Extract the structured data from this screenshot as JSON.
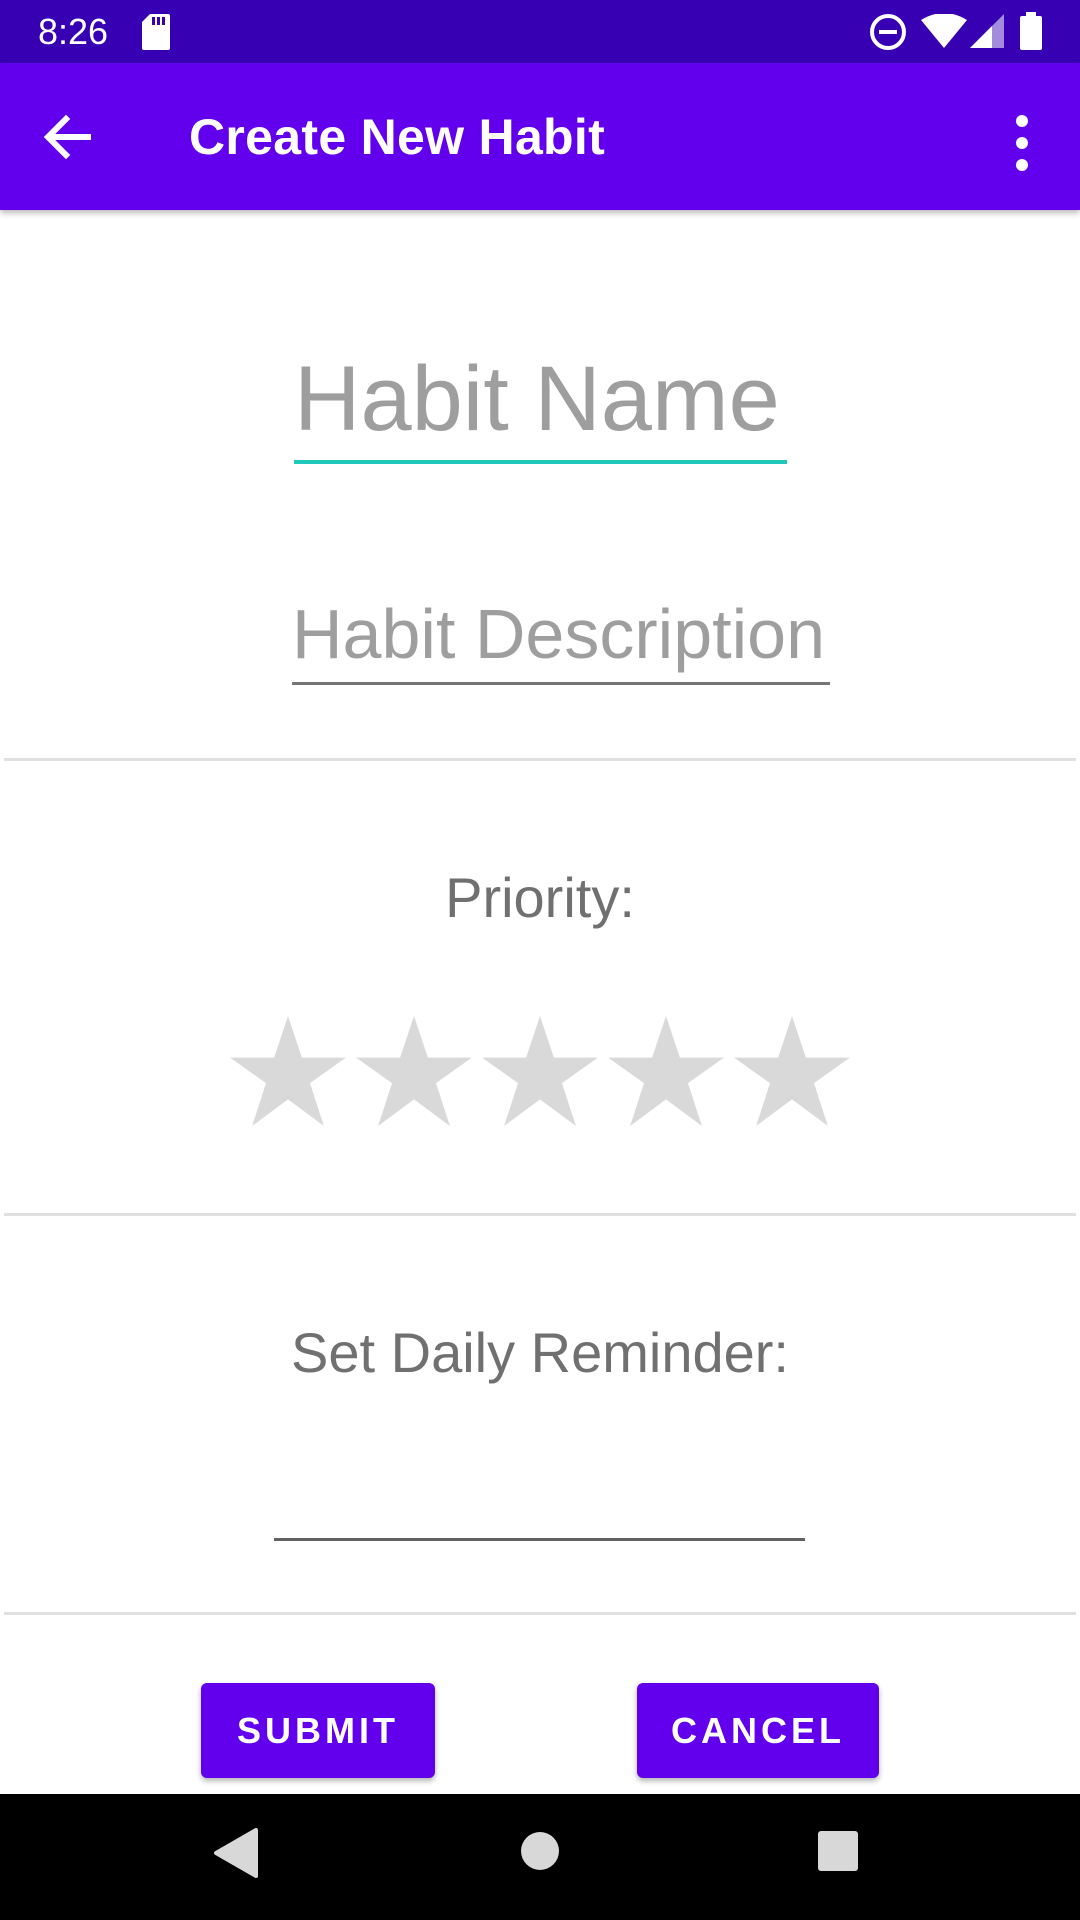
{
  "status_bar": {
    "time": "8:26",
    "icons": [
      "sd-card-icon",
      "do-not-disturb-icon",
      "wifi-icon",
      "signal-icon",
      "battery-icon"
    ]
  },
  "app_bar": {
    "title": "Create New Habit",
    "back_icon": "arrow-back-icon",
    "menu_icon": "more-vertical-icon",
    "color": "#6200ee"
  },
  "form": {
    "habit_name": {
      "placeholder": "Habit Name",
      "value": ""
    },
    "habit_description": {
      "placeholder": "Habit Description",
      "value": ""
    },
    "priority_label": "Priority:",
    "priority": {
      "rating": 0,
      "max": 5
    },
    "reminder_label": "Set Daily Reminder:",
    "reminder_value": ""
  },
  "buttons": {
    "submit_label": "SUBMIT",
    "cancel_label": "CANCEL"
  },
  "nav_bar": {
    "icons": [
      "back-triangle-icon",
      "home-circle-icon",
      "recents-square-icon"
    ]
  },
  "colors": {
    "status_bar": "#3700b3",
    "accent": "#1ec8bd",
    "star_empty": "#d9d9d9"
  }
}
